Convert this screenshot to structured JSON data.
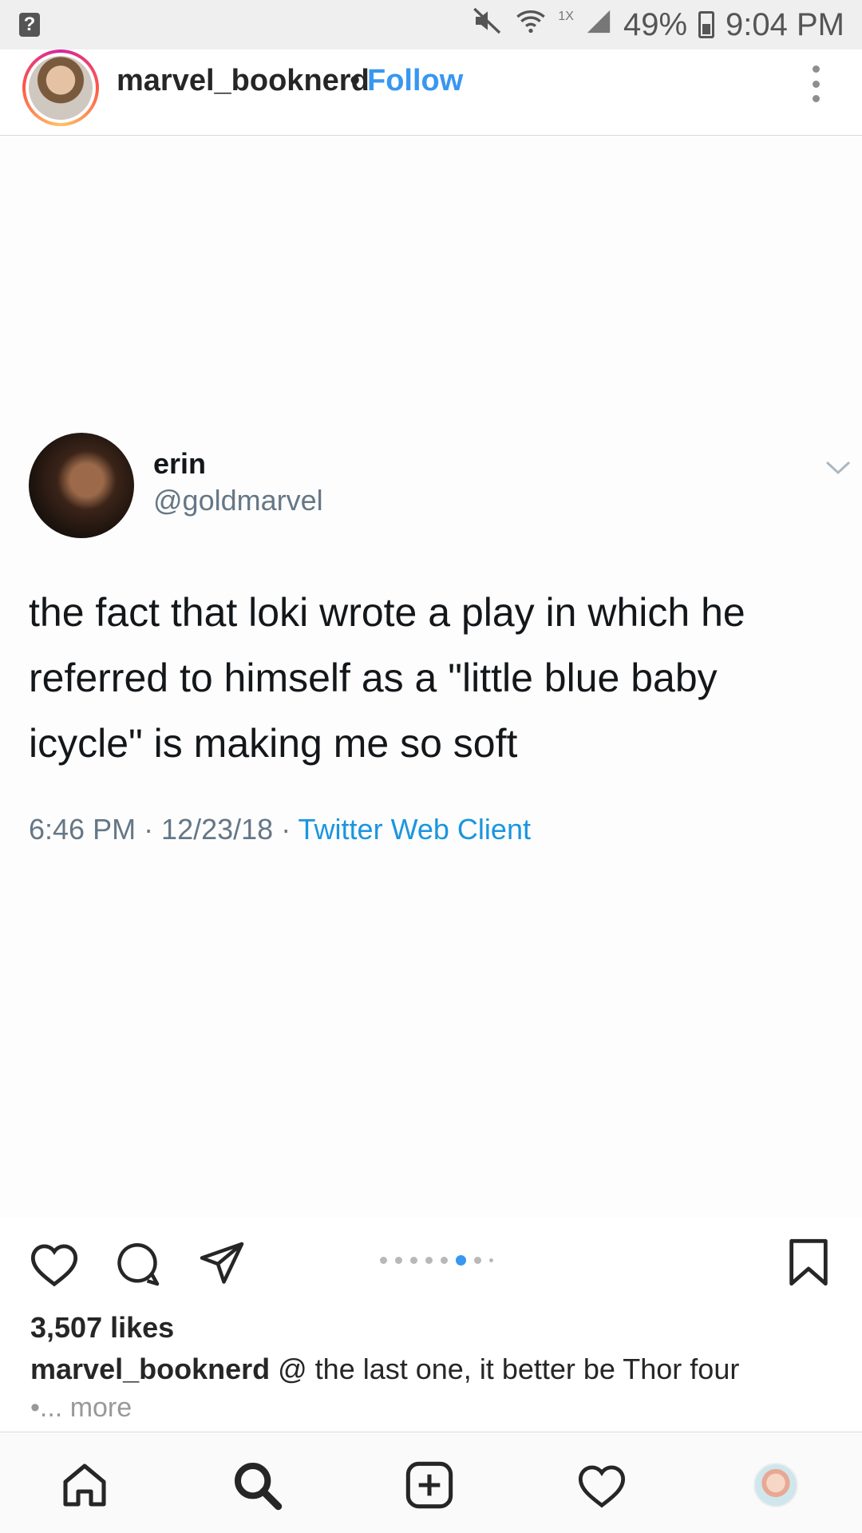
{
  "status_bar": {
    "unknown_icon": "?",
    "network_badge": "1X",
    "battery_percent": "49%",
    "time": "9:04 PM",
    "icons": [
      "mute-icon",
      "wifi-icon",
      "signal-icon",
      "battery-icon"
    ]
  },
  "post_header": {
    "username": "marvel_booknerd",
    "separator": "•",
    "follow_label": "Follow"
  },
  "tweet": {
    "name": "erin",
    "handle": "@goldmarvel",
    "text": "the fact that loki wrote a play in which he referred to himself as a \"little blue baby icycle\" is making me so soft",
    "meta_time": "6:46 PM · 12/23/18 · ",
    "meta_client": "Twitter Web Client"
  },
  "carousel": {
    "count": 8,
    "active_index": 5
  },
  "post_footer": {
    "likes": "3,507 likes",
    "caption_user": "marvel_booknerd",
    "caption_text": " @ the last one, it better be Thor four",
    "caption_more": "•... more"
  },
  "bottom_nav": {
    "items": [
      "home-icon",
      "search-icon",
      "add-post-icon",
      "activity-heart-icon",
      "profile-avatar"
    ]
  },
  "colors": {
    "accent": "#3897f0",
    "twitter_link": "#1b95e0",
    "text_primary": "#262626",
    "text_secondary": "#657786"
  }
}
